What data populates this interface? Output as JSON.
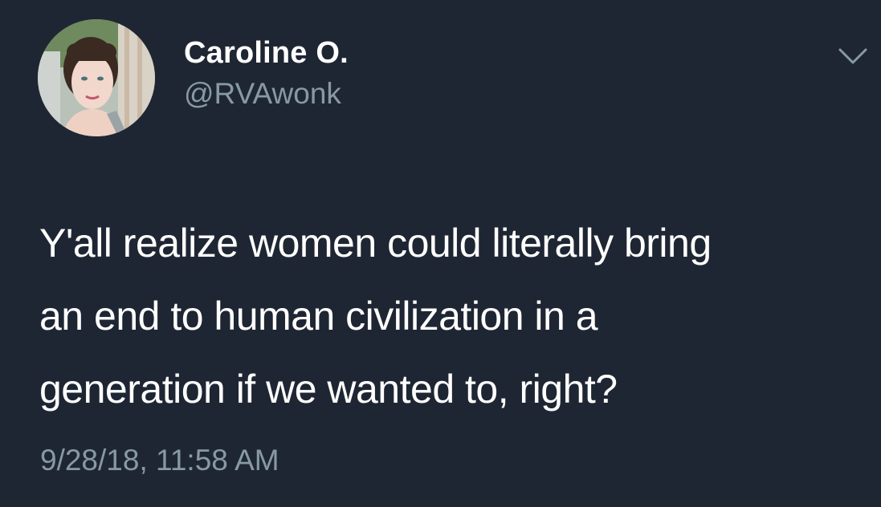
{
  "tweet": {
    "author": {
      "display_name": "Caroline O.",
      "handle": "@RVAwonk"
    },
    "text_lines": [
      "Y'all realize women could literally bring",
      "an end to human civilization in a",
      "generation if we wanted to, right?"
    ],
    "timestamp": "9/28/18, 11:58 AM"
  },
  "icons": {
    "menu": "chevron-down-icon",
    "avatar": "user-avatar"
  },
  "colors": {
    "background": "#1f2633",
    "primary_text": "#ffffff",
    "secondary_text": "#8899a6"
  }
}
